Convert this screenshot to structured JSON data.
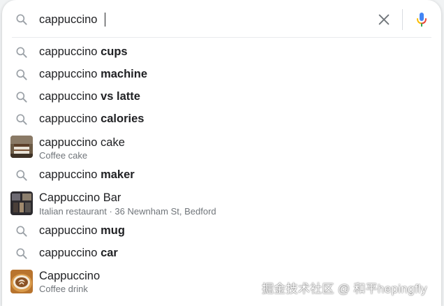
{
  "search": {
    "query": "cappuccino"
  },
  "suggestions": [
    {
      "prefix": "cappuccino",
      "completion": "cups"
    },
    {
      "prefix": "cappuccino",
      "completion": "machine"
    },
    {
      "prefix": "cappuccino",
      "completion": "vs latte"
    },
    {
      "prefix": "cappuccino",
      "completion": "calories"
    },
    {
      "title": "cappuccino cake",
      "subtitle": "Coffee cake"
    },
    {
      "prefix": "cappuccino",
      "completion": "maker"
    },
    {
      "title": "Cappuccino Bar",
      "subtitle": "Italian restaurant · 36 Newnham St, Bedford"
    },
    {
      "prefix": "cappuccino",
      "completion": "mug"
    },
    {
      "prefix": "cappuccino",
      "completion": "car"
    },
    {
      "title": "Cappuccino",
      "subtitle": "Coffee drink"
    }
  ],
  "icons": {
    "search": "search-icon",
    "clear": "close-icon",
    "voice": "microphone-icon"
  },
  "colors": {
    "icon_gray": "#9aa0a6",
    "text": "#202124",
    "subtext": "#70757a",
    "mic_blue": "#4285f4",
    "mic_red": "#ea4335",
    "mic_yellow": "#fbbc04",
    "mic_green": "#34a853"
  },
  "watermark": "掘金技术社区 @ 和平hepingfly"
}
